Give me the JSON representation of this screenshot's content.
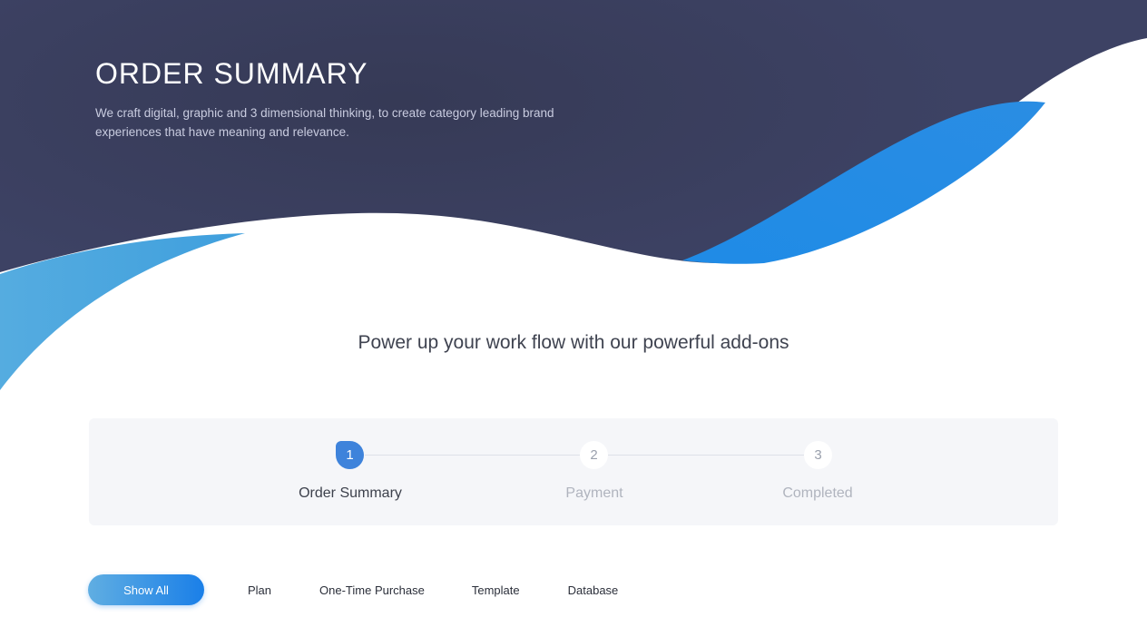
{
  "hero": {
    "title": "ORDER SUMMARY",
    "description": "We craft digital, graphic and 3 dimensional thinking, to create category leading brand experiences that have meaning and relevance."
  },
  "tagline": "Power up your work flow with our powerful add-ons",
  "stepper": {
    "steps": [
      {
        "number": "1",
        "label": "Order Summary",
        "state": "active"
      },
      {
        "number": "2",
        "label": "Payment",
        "state": "inactive"
      },
      {
        "number": "3",
        "label": "Completed",
        "state": "inactive"
      }
    ]
  },
  "filters": {
    "active": "Show All",
    "items": [
      {
        "label": "Show All"
      },
      {
        "label": "Plan"
      },
      {
        "label": "One-Time Purchase"
      },
      {
        "label": "Template"
      },
      {
        "label": "Database"
      }
    ]
  },
  "colors": {
    "hero_dark": "#3b3f5f",
    "accent_blue": "#1f87e5",
    "wave_light_blue": "#4aa2dc",
    "stepper_bg": "#f5f6f9",
    "active_step": "#3e83db"
  }
}
